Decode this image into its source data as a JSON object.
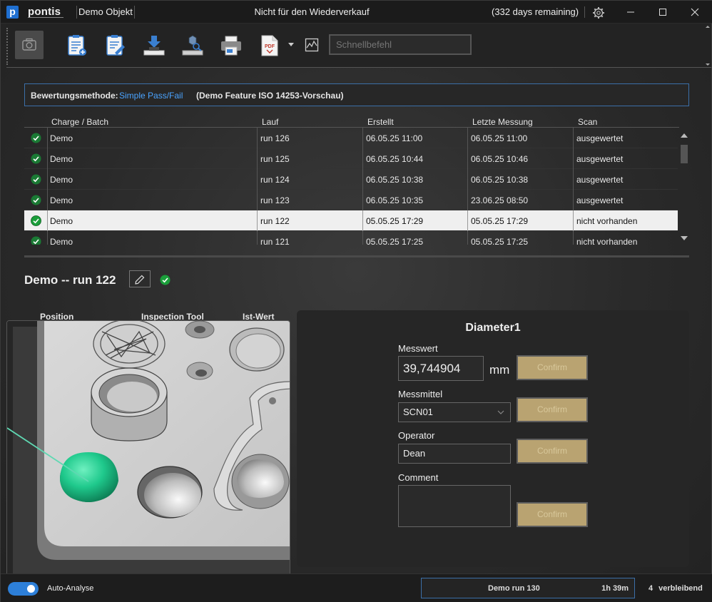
{
  "titlebar": {
    "logo_letter": "p",
    "brand": "pontis",
    "project": "Demo Objekt",
    "center_title": "Nicht für den Wiederverkauf",
    "license": "(332 days remaining)"
  },
  "toolbar": {
    "command_placeholder": "Schnellbefehl",
    "pdf_text": "PDF"
  },
  "method": {
    "label": "Bewertungsmethode:",
    "value": "Simple Pass/Fail",
    "note": "(Demo Feature ISO 14253-Vorschau)"
  },
  "table": {
    "columns": [
      "Charge / Batch",
      "Lauf",
      "Erstellt",
      "Letzte Messung",
      "Scan"
    ],
    "rows": [
      {
        "batch": "Demo",
        "run": "run  126",
        "created": "06.05.25 11:00",
        "last": "06.05.25 11:00",
        "scan": "ausgewertet",
        "selected": false
      },
      {
        "batch": "Demo",
        "run": "run  125",
        "created": "06.05.25 10:44",
        "last": "06.05.25 10:46",
        "scan": "ausgewertet",
        "selected": false
      },
      {
        "batch": "Demo",
        "run": "run  124",
        "created": "06.05.25 10:38",
        "last": "06.05.25 10:38",
        "scan": "ausgewertet",
        "selected": false
      },
      {
        "batch": "Demo",
        "run": "run  123",
        "created": "06.05.25 10:35",
        "last": "23.06.25 08:50",
        "scan": "ausgewertet",
        "selected": false
      },
      {
        "batch": "Demo",
        "run": "run  122",
        "created": "05.05.25 17:29",
        "last": "05.05.25 17:29",
        "scan": "nicht vorhanden",
        "selected": true
      },
      {
        "batch": "Demo",
        "run": "run  121",
        "created": "05.05.25 17:25",
        "last": "05.05.25 17:25",
        "scan": "nicht vorhanden",
        "selected": false
      }
    ]
  },
  "detail": {
    "title": "Demo -- run  122",
    "columns": [
      "Position",
      "Inspection Tool",
      "Ist-Wert"
    ]
  },
  "panel": {
    "feature": "Diameter1",
    "messwert_label": "Messwert",
    "messwert_value": "39,744904",
    "unit": "mm",
    "messmittel_label": "Messmittel",
    "messmittel_value": "SCN01",
    "operator_label": "Operator",
    "operator_value": "Dean",
    "comment_label": "Comment",
    "comment_value": "",
    "confirm_label": "Confirm"
  },
  "status": {
    "auto_label": "Auto-Analyse",
    "queue_name": "Demo  run  130",
    "queue_time": "1h 39m",
    "remaining_count": "4",
    "remaining_label": "verbleibend"
  },
  "colors": {
    "accent": "#2d7fd8",
    "link": "#4aa3ff",
    "ok_green": "#1a9e3a",
    "confirm": "#b9a371",
    "highlight_feature": "#18c98a"
  }
}
